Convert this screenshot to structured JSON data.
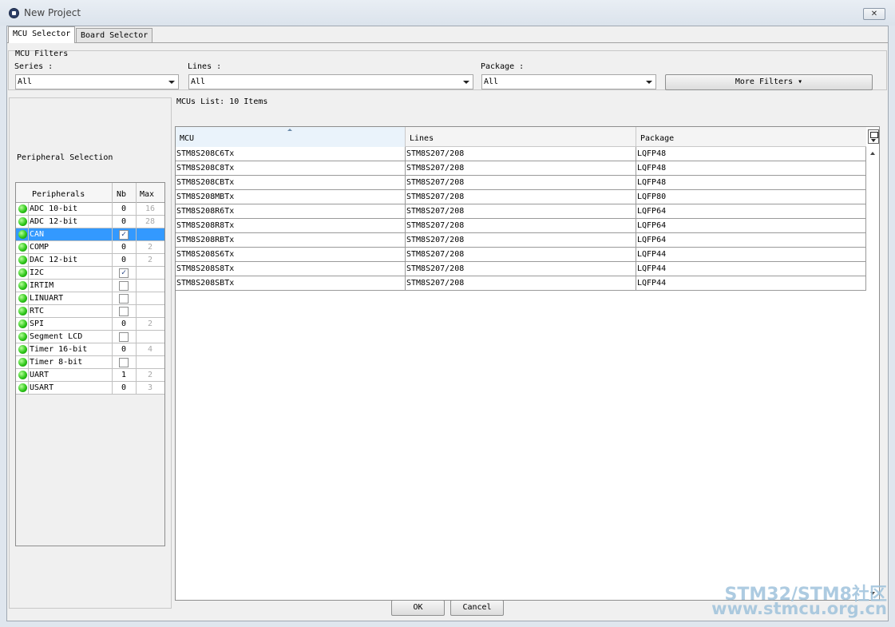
{
  "window": {
    "title": "New Project",
    "close_label": "✕"
  },
  "tabs": [
    "MCU Selector",
    "Board Selector"
  ],
  "filters": {
    "group_title": "MCU Filters",
    "series_label": "Series :",
    "series_value": "All",
    "lines_label": "Lines :",
    "lines_value": "All",
    "package_label": "Package :",
    "package_value": "All",
    "more_filters_label": "More Filters ▾"
  },
  "peripherals": {
    "group_title": "Peripheral Selection",
    "headers": {
      "name": "Peripherals",
      "nb": "Nb",
      "max": "Max"
    },
    "rows": [
      {
        "name": "ADC 10-bit",
        "nb": "0",
        "max": "16"
      },
      {
        "name": "ADC 12-bit",
        "nb": "0",
        "max": "28"
      },
      {
        "name": "CAN",
        "check": true,
        "selected": true
      },
      {
        "name": "COMP",
        "nb": "0",
        "max": "2"
      },
      {
        "name": "DAC 12-bit",
        "nb": "0",
        "max": "2"
      },
      {
        "name": "I2C",
        "check": true
      },
      {
        "name": "IRTIM",
        "check": false
      },
      {
        "name": "LINUART",
        "check": false
      },
      {
        "name": "RTC",
        "check": false
      },
      {
        "name": "SPI",
        "nb": "0",
        "max": "2"
      },
      {
        "name": "Segment LCD",
        "check": false
      },
      {
        "name": "Timer 16-bit",
        "nb": "0",
        "max": "4"
      },
      {
        "name": "Timer 8-bit",
        "check": false
      },
      {
        "name": "UART",
        "nb": "1",
        "max": "2"
      },
      {
        "name": "USART",
        "nb": "0",
        "max": "3"
      }
    ]
  },
  "mcu_list": {
    "title": "MCUs List: 10 Items",
    "columns": [
      "MCU",
      "Lines",
      "Package"
    ],
    "rows": [
      [
        "STM8S208C6Tx",
        "STM8S207/208",
        "LQFP48"
      ],
      [
        "STM8S208C8Tx",
        "STM8S207/208",
        "LQFP48"
      ],
      [
        "STM8S208CBTx",
        "STM8S207/208",
        "LQFP48"
      ],
      [
        "STM8S208MBTx",
        "STM8S207/208",
        "LQFP80"
      ],
      [
        "STM8S208R6Tx",
        "STM8S207/208",
        "LQFP64"
      ],
      [
        "STM8S208R8Tx",
        "STM8S207/208",
        "LQFP64"
      ],
      [
        "STM8S208RBTx",
        "STM8S207/208",
        "LQFP64"
      ],
      [
        "STM8S208S6Tx",
        "STM8S207/208",
        "LQFP44"
      ],
      [
        "STM8S208S8Tx",
        "STM8S207/208",
        "LQFP44"
      ],
      [
        "STM8S208SBTx",
        "STM8S207/208",
        "LQFP44"
      ]
    ]
  },
  "footer": {
    "ok_label": "OK",
    "cancel_label": "Cancel"
  },
  "watermark": {
    "line1": "STM32/STM8社区",
    "line2": "www.stmcu.org.cn"
  }
}
